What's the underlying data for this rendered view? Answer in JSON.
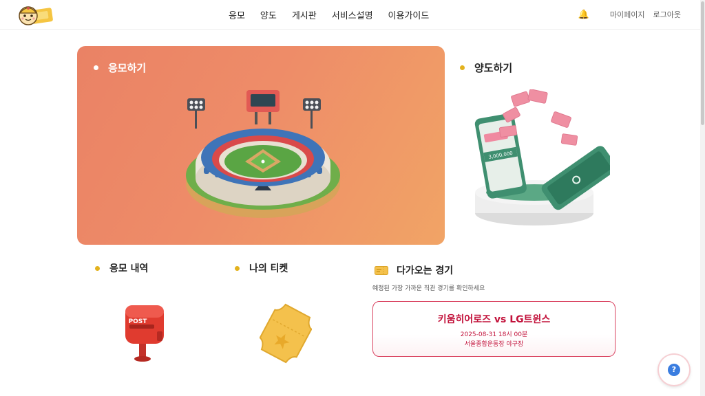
{
  "header": {
    "nav": [
      "응모",
      "양도",
      "게시판",
      "서비스설명",
      "이용가이드"
    ],
    "mypage": "마이페이지",
    "logout": "로그아웃"
  },
  "hero": {
    "title": "응모하기"
  },
  "transfer": {
    "title": "양도하기",
    "phone_amount": "3,000,000"
  },
  "apply_history": {
    "title": "응모 내역",
    "mailbox_text": "POST"
  },
  "my_ticket": {
    "title": "나의 티켓"
  },
  "upcoming": {
    "title": "다가오는 경기",
    "subtitle": "예정된 가장 가까운 직관 경기를 확인하세요",
    "match": "키움히어로즈 vs LG트윈스",
    "datetime": "2025-08-31 18시 00분",
    "venue": "서울종합운동장 야구장"
  },
  "help": {
    "label": "?"
  },
  "colors": {
    "accent_red": "#c2113a",
    "dot_yellow": "#e3b21e",
    "hero_orange": "#ee8c68"
  }
}
